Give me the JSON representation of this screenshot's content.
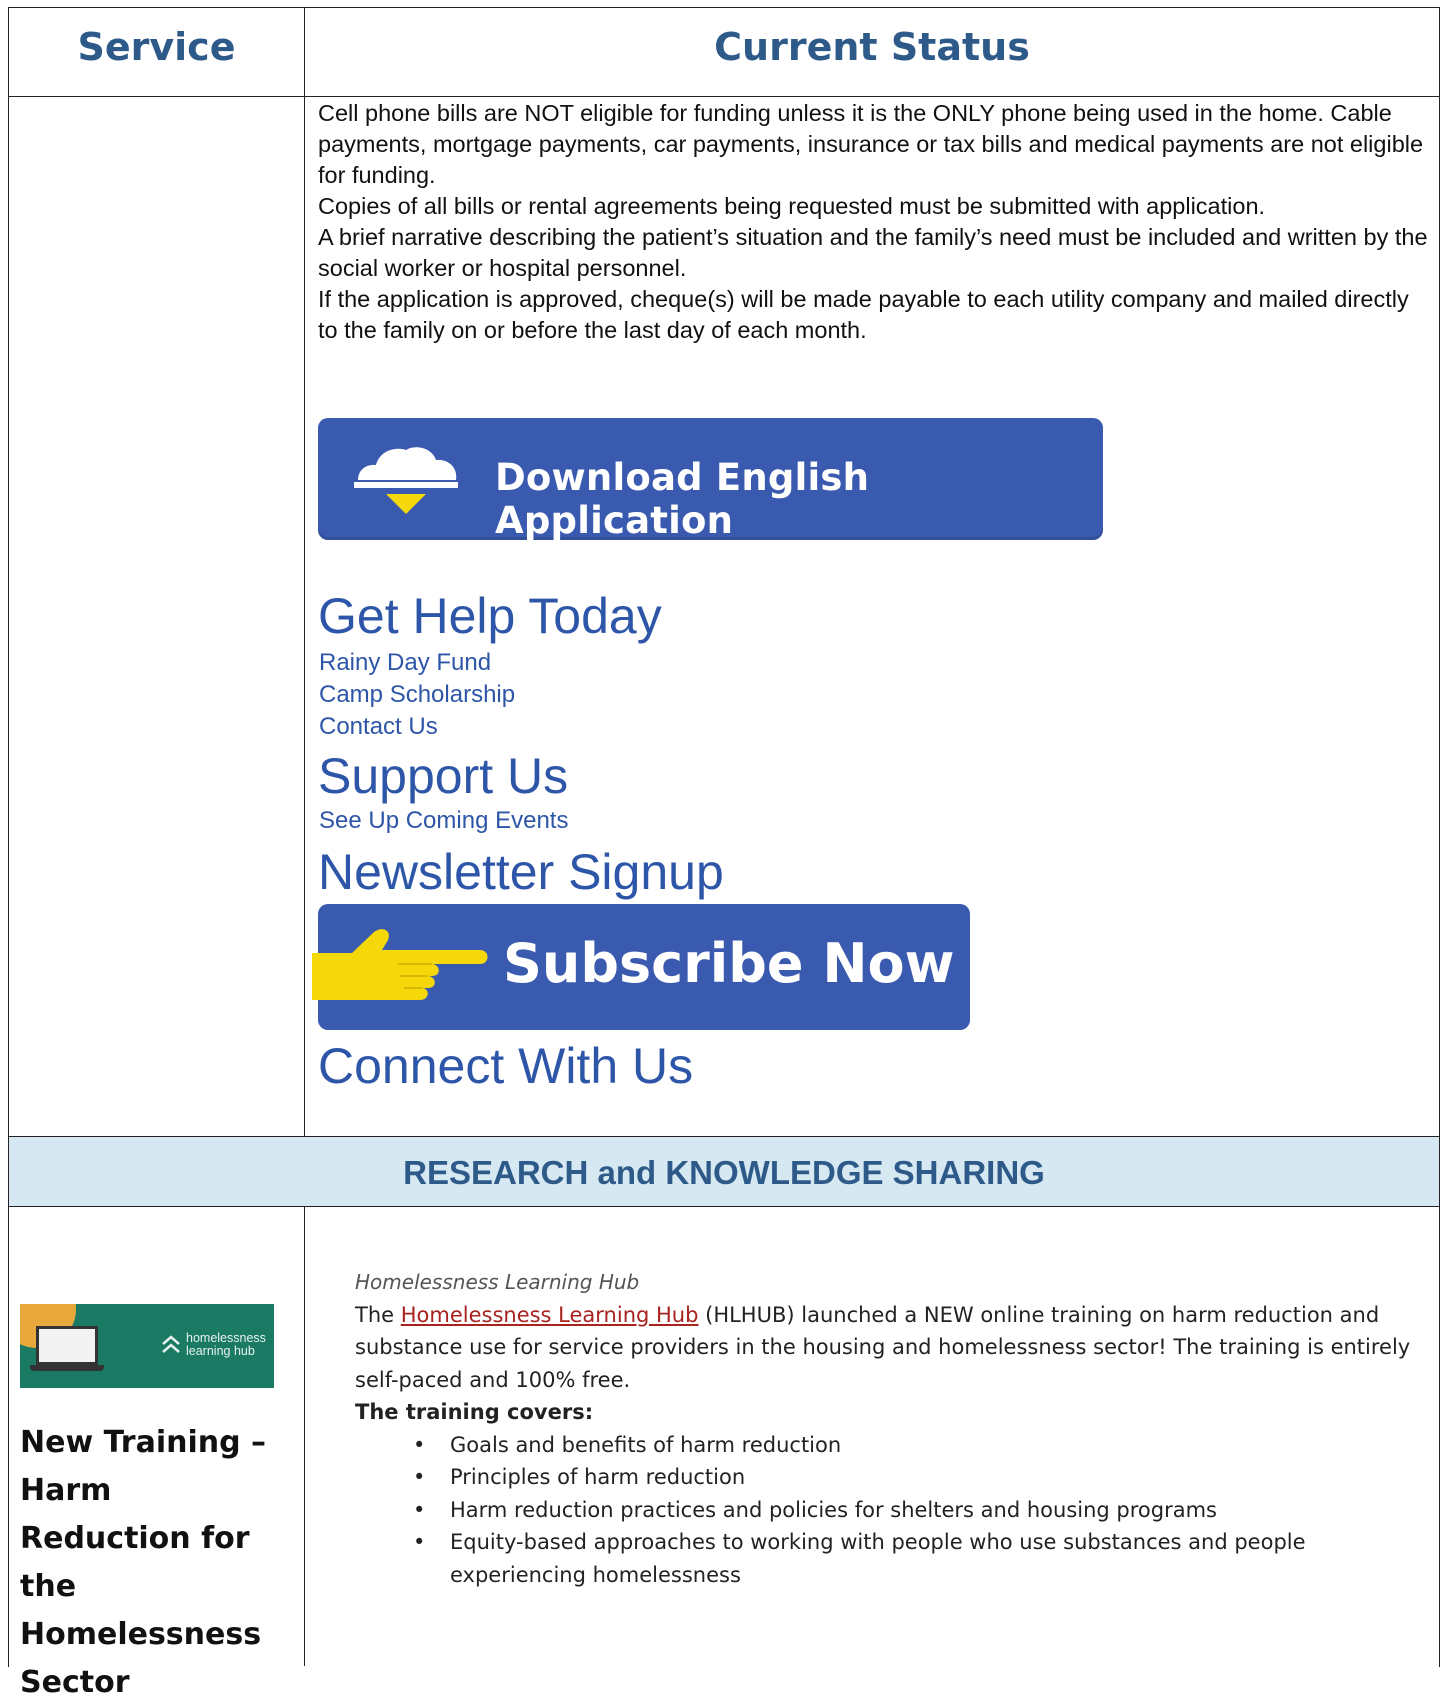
{
  "header": {
    "col1": "Service",
    "col2": "Current Status"
  },
  "status": {
    "paragraphs": [
      "Cell phone bills are NOT eligible for funding unless it is the ONLY phone being used in the home. Cable payments, mortgage payments, car payments, insurance or tax bills and medical payments are not eligible for funding.",
      "Copies of all bills or rental agreements being requested must be submitted with application.",
      "A brief narrative describing the patient’s situation and the family’s need must be included and written by the social worker or hospital personnel.",
      "If the application is approved, cheque(s) will be made payable to each utility company and mailed directly to the family on or before the last day of each month."
    ],
    "download_label": "Download English Application",
    "get_help": "Get Help Today",
    "links_help": [
      "Rainy Day Fund",
      "Camp Scholarship",
      "Contact Us"
    ],
    "support": "Support Us",
    "events_link": "See Up Coming Events",
    "newsletter": "Newsletter Signup",
    "subscribe_label": "Subscribe Now",
    "connect": "Connect With Us"
  },
  "band": {
    "title": "RESEARCH and KNOWLEDGE SHARING"
  },
  "research": {
    "thumb_brand_line1": "homelessness",
    "thumb_brand_line2": "learning hub",
    "side_title": "New Training – Harm Reduction for the Homelessness Sector",
    "hub_label": "Homelessness Learning Hub",
    "intro_before": "The ",
    "intro_link": "Homelessness Learning Hub",
    "intro_after": " (HLHUB) launched a NEW online training on harm reduction and substance use for service providers in the housing and homelessness sector! The training is entirely self-paced and 100% free.",
    "covers_title": "The training covers:",
    "bullets": [
      "Goals and benefits of harm reduction",
      "Principles of harm reduction",
      "Harm reduction practices and policies for shelters and housing programs",
      "Equity-based approaches to working with people who use substances and people experiencing homelessness"
    ]
  },
  "colors": {
    "heading_blue": "#2e5a8a",
    "link_blue": "#2e56a8",
    "button_blue": "#3a5ab0",
    "band_bg": "#d6e8f2",
    "link_red": "#a8221e",
    "hand_yellow": "#f5d80a"
  }
}
